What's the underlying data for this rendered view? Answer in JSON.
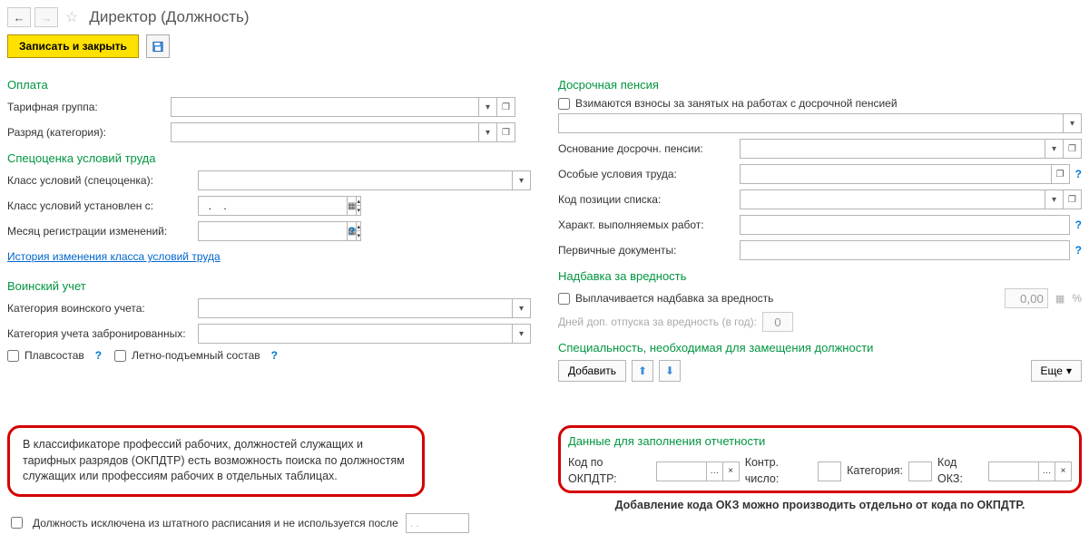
{
  "header": {
    "title": "Директор (Должность)"
  },
  "actions": {
    "save_close": "Записать и закрыть"
  },
  "left": {
    "payment": {
      "title": "Оплата",
      "tariff_group": "Тарифная группа:",
      "grade": "Разряд (категория):"
    },
    "spec": {
      "title": "Спецоценка условий труда",
      "class": "Класс условий (спецоценка):",
      "class_from": "Класс условий установлен с:",
      "date_placeholder": "  .    .",
      "reg_month": "Месяц регистрации изменений:",
      "history_link": "История изменения класса условий труда"
    },
    "military": {
      "title": "Воинский учет",
      "category": "Категория воинского учета:",
      "booked": "Категория учета забронированных:",
      "crew": "Плавсостав",
      "flight": "Летно-подъемный состав"
    },
    "callout": "В классификаторе профессий рабочих, должностей служащих и тарифных разрядов (ОКПДТР) есть возможность поиска по должностям служащих или профессиям рабочих в отдельных таблицах.",
    "excluded": "Должность исключена из штатного расписания и не используется после",
    "excluded_date": ". ."
  },
  "right": {
    "pension": {
      "title": "Досрочная пенсия",
      "fees": "Взимаются взносы за занятых на работах с досрочной пенсией",
      "basis": "Основание досрочн. пенсии:",
      "conditions": "Особые условия труда:",
      "list_code": "Код позиции списка:",
      "work_char": "Характ. выполняемых работ:",
      "primary_docs": "Первичные документы:"
    },
    "hazard": {
      "title": "Надбавка за вредность",
      "paid": "Выплачивается надбавка за вредность",
      "value": "0,00",
      "pct": "%",
      "days": "Дней доп. отпуска за вредность (в год):",
      "days_val": "0"
    },
    "speciality": {
      "title": "Специальность, необходимая для замещения должности",
      "add": "Добавить",
      "more": "Еще"
    },
    "report": {
      "title": "Данные для заполнения отчетности",
      "okpdtr": "Код по ОКПДТР:",
      "control": "Контр. число:",
      "category": "Категория:",
      "okz": "Код ОКЗ:"
    },
    "bottom_note": "Добавление кода ОКЗ можно производить отдельно от кода по ОКПДТР."
  }
}
